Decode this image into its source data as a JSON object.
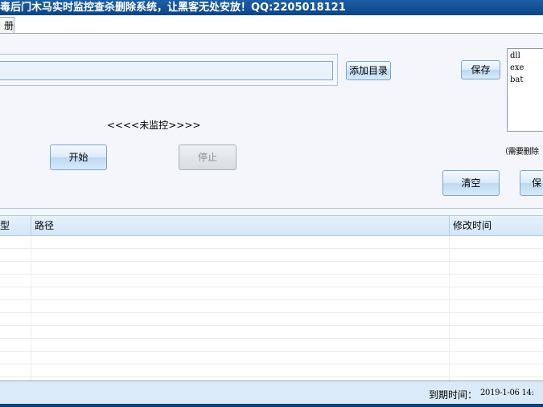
{
  "title": "毒后门木马实时监控查杀删除系统，让黑客无处安放！QQ:2205018121",
  "tab_label": "册",
  "path_input": {
    "value": ""
  },
  "add_dir_button": "添加目录",
  "save_ext_button": "保存",
  "extensions": [
    "dll",
    "exe",
    "bat"
  ],
  "monitor_status": "<<<<未监控>>>>",
  "start_button": "开始",
  "stop_button": "停止",
  "delete_hint": "（需要删除",
  "clear_button": "清空",
  "save_button2": "保",
  "table": {
    "columns": [
      "型",
      "路径",
      "修改时间"
    ],
    "rows": []
  },
  "status": {
    "expiry_label": "到期时间：",
    "expiry_value": "2019-1-06 14:"
  }
}
